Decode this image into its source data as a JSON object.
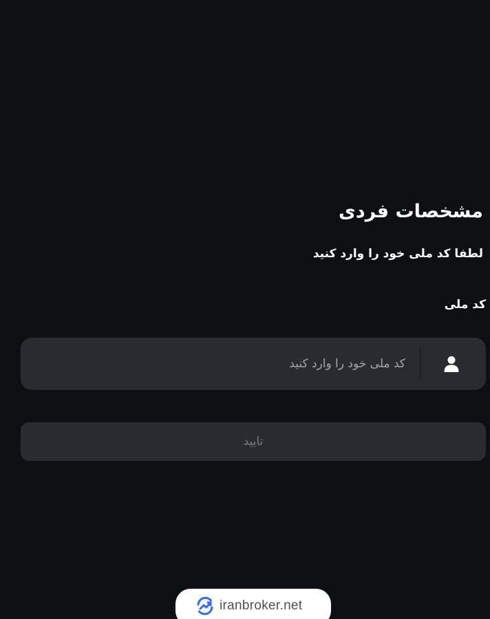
{
  "header": {
    "title": "مشخصات فردی",
    "subtitle": "لطفا کد ملی خود را وارد کنید"
  },
  "form": {
    "national_id": {
      "label": "کد ملی",
      "placeholder": "کد ملی خود را وارد کنید",
      "value": "",
      "icon": "user-icon"
    },
    "submit_label": "تایید"
  },
  "footer": {
    "brand_text": "iranbroker.net",
    "logo_icon": "trend-logo-icon"
  },
  "colors": {
    "background": "#0e0f12",
    "surface": "#2a2b31",
    "text_primary": "#ffffff",
    "placeholder": "#a3a4a9",
    "button_text_disabled": "#7b7c82",
    "brand_blue": "#2f6cf6"
  }
}
